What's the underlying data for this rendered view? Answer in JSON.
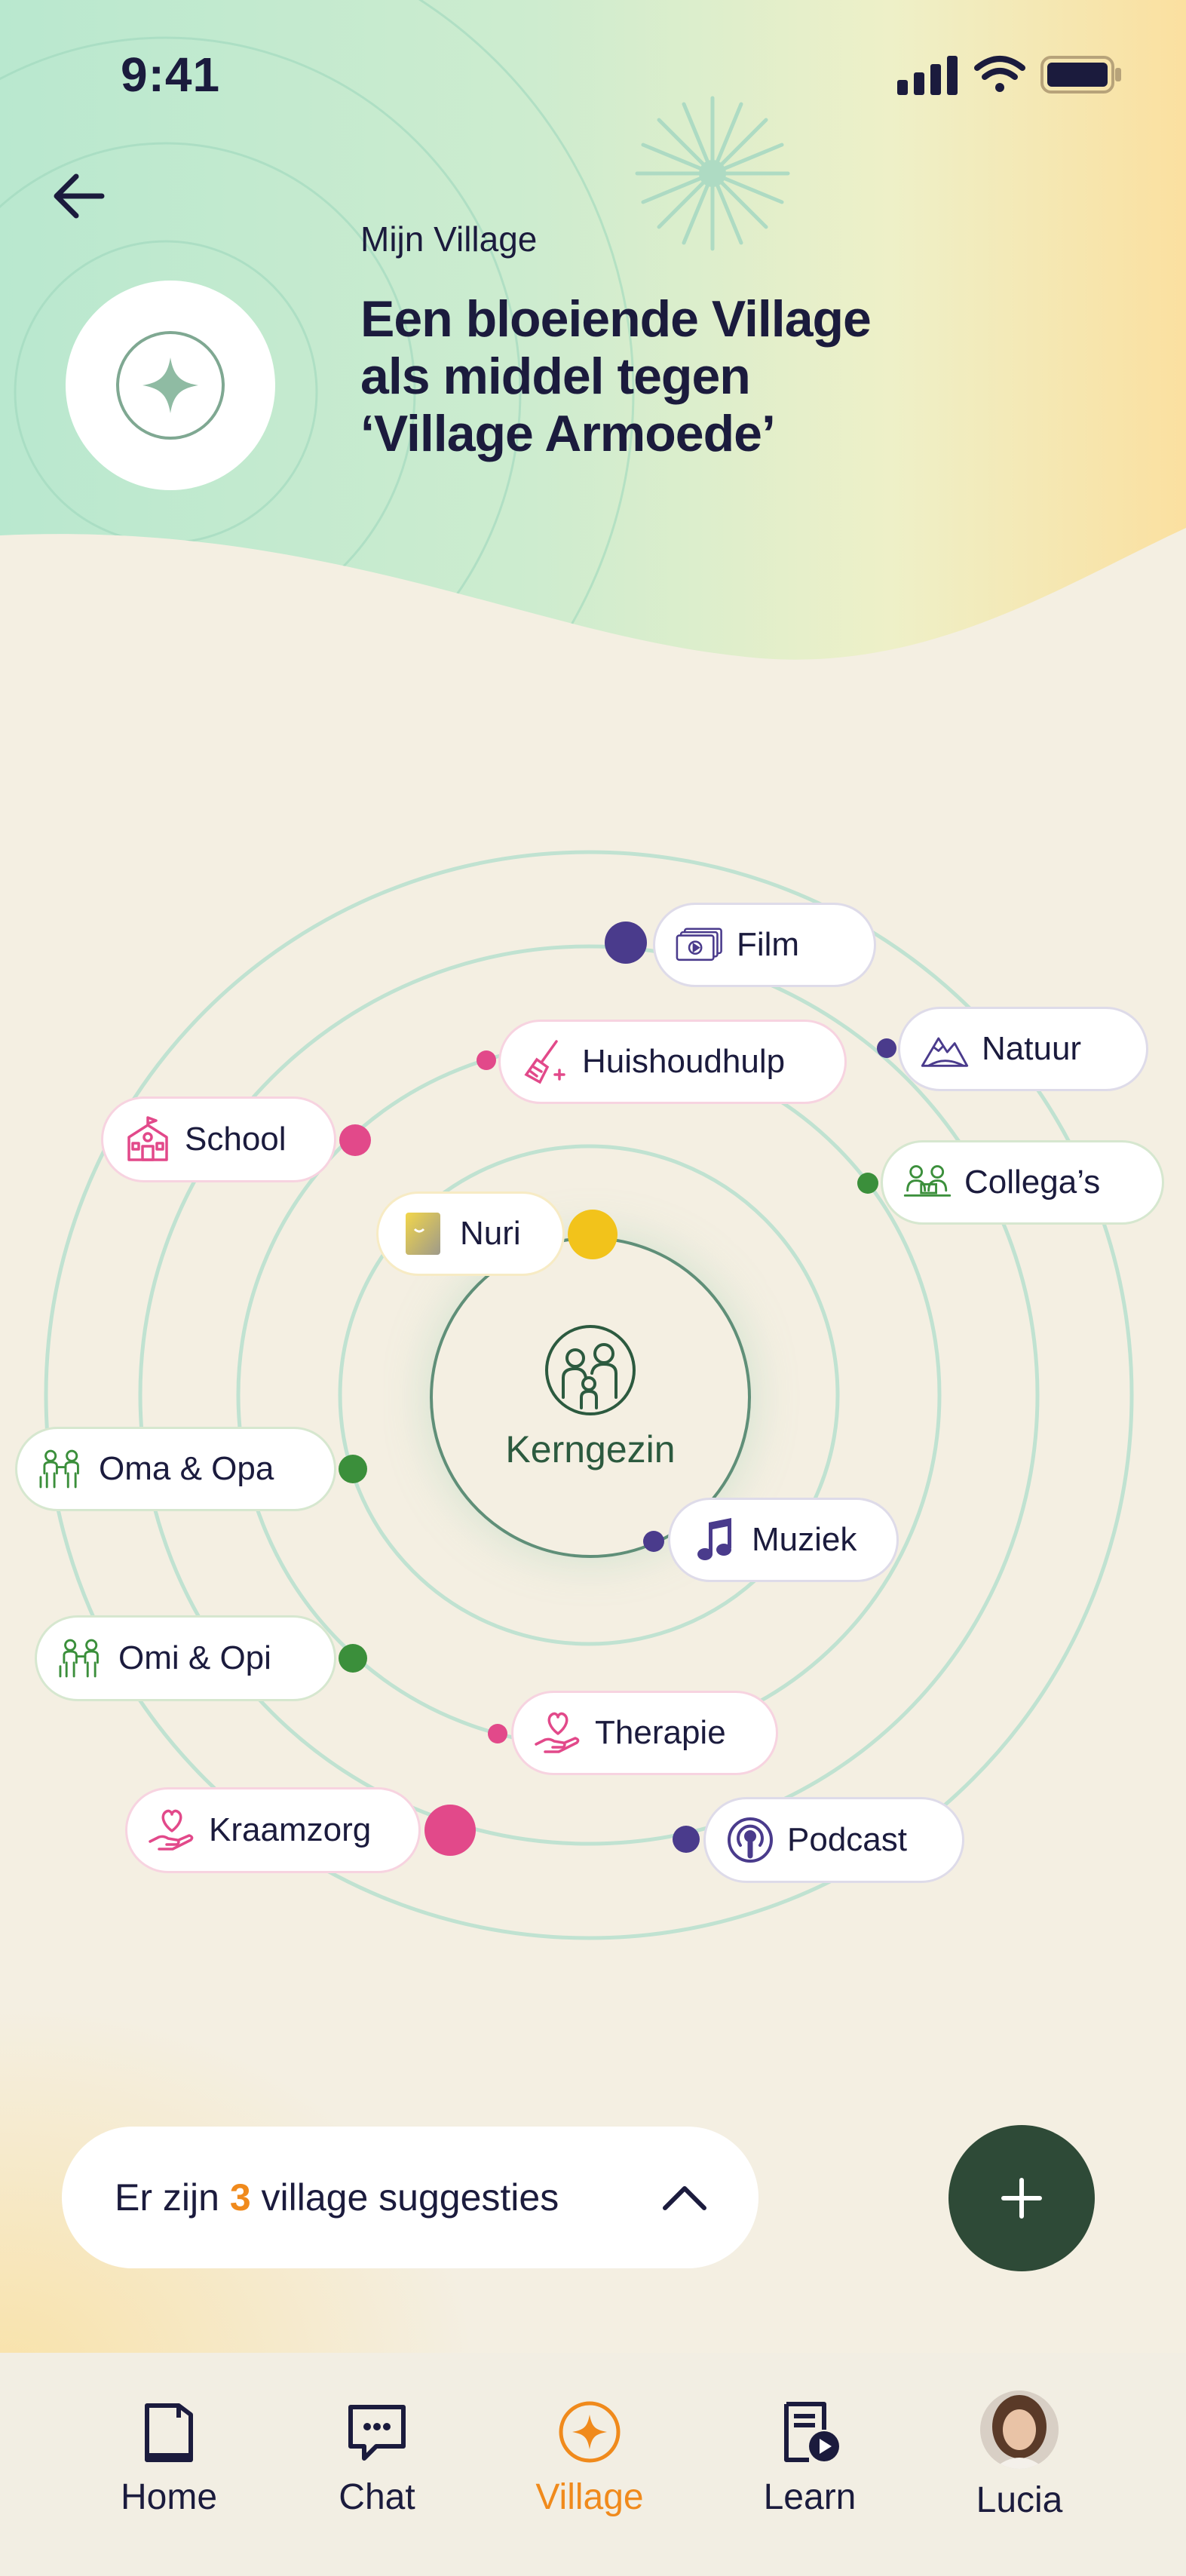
{
  "status_bar": {
    "time": "9:41"
  },
  "header": {
    "section_label": "Mijn Village",
    "title_lines": [
      "Een bloeiende Village",
      "als middel tegen",
      "‘Village Armoede’"
    ]
  },
  "village": {
    "center_label": "Kerngezin",
    "nodes": [
      {
        "label": "Film",
        "icon": "film-icon",
        "color": "#4a3b8c"
      },
      {
        "label": "Natuur",
        "icon": "mountain-icon",
        "color": "#4a3b8c"
      },
      {
        "label": "Huishoudhulp",
        "icon": "broom-icon",
        "color": "#e2498a"
      },
      {
        "label": "School",
        "icon": "school-icon",
        "color": "#e2498a"
      },
      {
        "label": "Collega’s",
        "icon": "colleagues-icon",
        "color": "#3b8f3b"
      },
      {
        "label": "Nuri",
        "icon": "nuri-photo",
        "color": "#f2c31b"
      },
      {
        "label": "Oma & Opa",
        "icon": "grandparents-icon",
        "color": "#3b8f3b"
      },
      {
        "label": "Muziek",
        "icon": "music-note-icon",
        "color": "#4a3b8c"
      },
      {
        "label": "Omi & Opi",
        "icon": "grandparents-icon",
        "color": "#3b8f3b"
      },
      {
        "label": "Therapie",
        "icon": "heart-hand-icon",
        "color": "#e2498a"
      },
      {
        "label": "Kraamzorg",
        "icon": "heart-hand-icon",
        "color": "#e2498a"
      },
      {
        "label": "Podcast",
        "icon": "podcast-icon",
        "color": "#4a3b8c"
      }
    ]
  },
  "suggestions": {
    "prefix": "Er zijn ",
    "count": "3",
    "suffix": " village suggesties"
  },
  "nav": {
    "items": [
      {
        "label": "Home",
        "icon": "book-icon"
      },
      {
        "label": "Chat",
        "icon": "chat-icon"
      },
      {
        "label": "Village",
        "icon": "village-star-icon"
      },
      {
        "label": "Learn",
        "icon": "learn-video-icon"
      },
      {
        "label": "Lucia",
        "icon": "avatar"
      }
    ],
    "active": "Village"
  },
  "colors": {
    "accent": "#f08a1c",
    "ring": "#bfe0cf",
    "dark_green": "#2e4a37",
    "text": "#1b1b3d"
  }
}
